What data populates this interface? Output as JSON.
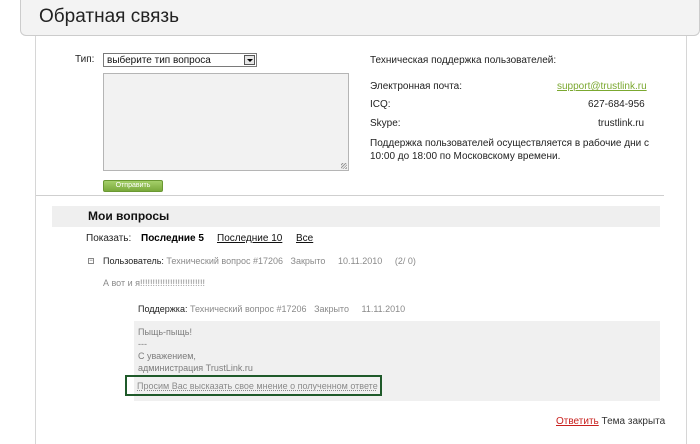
{
  "page": {
    "title": "Обратная связь"
  },
  "form": {
    "type_label": "Тип:",
    "type_select_value": "выберите тип вопроса",
    "send_label": "Отправить"
  },
  "support": {
    "heading": "Техническая поддержка пользователей:",
    "email_label": "Электронная почта:",
    "email_value": "support@trustlink.ru",
    "icq_label": "ICQ:",
    "icq_value": "627-684-956",
    "skype_label": "Skype:",
    "skype_value": "trustlink.ru",
    "hours_line1": "Поддержка пользователей осуществляется в рабочие дни с",
    "hours_line2": "10:00 до 18:00 по Московскому времени."
  },
  "my_questions": {
    "title": "Мои вопросы",
    "show_label": "Показать:",
    "tabs": [
      "Последние 5",
      "Последние 10",
      "Все"
    ],
    "question": {
      "author_label": "Пользователь:",
      "subject": "Технический вопрос #17206",
      "status": "Закрыто",
      "date": "10.11.2010",
      "count": "(2/ 0)",
      "body": "А вот и я!!!!!!!!!!!!!!!!!!!!!!!!!!"
    },
    "reply": {
      "author_label": "Поддержка:",
      "subject": "Технический вопрос #17206",
      "status": "Закрыто",
      "date": "11.11.2010",
      "line1": "Пыщь-пыщь!",
      "line2": "---",
      "line3": "С уважением,",
      "line4": "администрация TrustLink.ru",
      "opinion_link": "Просим Вас высказать свое мнение о полученном ответе"
    },
    "answer_link": "Ответить",
    "closed_text": "Тема закрыта"
  }
}
